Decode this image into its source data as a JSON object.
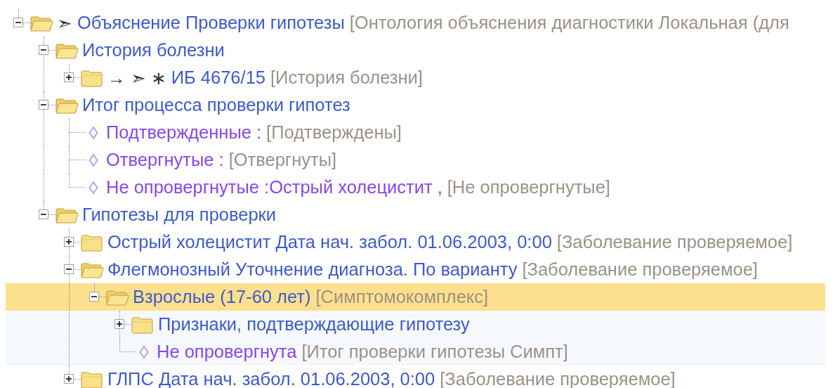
{
  "tree": [
    {
      "kind": "folder",
      "expanded": true,
      "selected": false,
      "prefix": "➣",
      "label": "Объяснение Проверки гипотезы",
      "type": "[Онтология объяснения диагностики Локальная (для",
      "children": [
        {
          "kind": "folder",
          "expanded": true,
          "selected": false,
          "label": "История болезни",
          "children": [
            {
              "kind": "folder",
              "expanded": false,
              "selected": false,
              "prefix": "→  ➣ ∗",
              "label": "ИБ 4676/15",
              "type": "[История болезни]"
            }
          ]
        },
        {
          "kind": "folder",
          "expanded": true,
          "selected": false,
          "label": "Итог процесса проверки гипотез",
          "children": [
            {
              "kind": "leaf",
              "selected": false,
              "label": "Подтвержденные :",
              "type": "[Подтверждены]"
            },
            {
              "kind": "leaf",
              "selected": false,
              "label": "Отвергнутые :",
              "type": "[Отвергнуты]"
            },
            {
              "kind": "leaf",
              "selected": false,
              "label": "Не опровергнутые :Острый холецистит ,",
              "type": "[Не опровергнутые]"
            }
          ]
        },
        {
          "kind": "folder",
          "expanded": true,
          "selected": false,
          "label": "Гипотезы для проверки",
          "children": [
            {
              "kind": "folder",
              "expanded": false,
              "selected": false,
              "label": "Острый холецистит Дата нач. забол. 01.06.2003, 0:00",
              "type": "[Заболевание проверяемое]"
            },
            {
              "kind": "folder",
              "expanded": true,
              "selected": false,
              "label": "Флегмонозный Уточнение диагноза. По варианту",
              "type": "[Заболевание проверяемое]",
              "children": [
                {
                  "kind": "folder",
                  "expanded": true,
                  "selected": true,
                  "label": "Взрослые (17-60 лет)",
                  "type": "[Симптомокомплекс]",
                  "children": [
                    {
                      "kind": "folder",
                      "expanded": false,
                      "selected": false,
                      "label": "Признаки, подтверждающие гипотезу"
                    },
                    {
                      "kind": "leaf",
                      "selected": false,
                      "label": "Не опровергнута",
                      "type": "[Итог проверки гипотезы Симпт]"
                    }
                  ]
                }
              ]
            },
            {
              "kind": "folder",
              "expanded": false,
              "selected": false,
              "label": "ГЛПС Дата нач. забол. 01.06.2003, 0:00",
              "type": "[Заболевание проверяемое]"
            }
          ]
        }
      ]
    }
  ]
}
